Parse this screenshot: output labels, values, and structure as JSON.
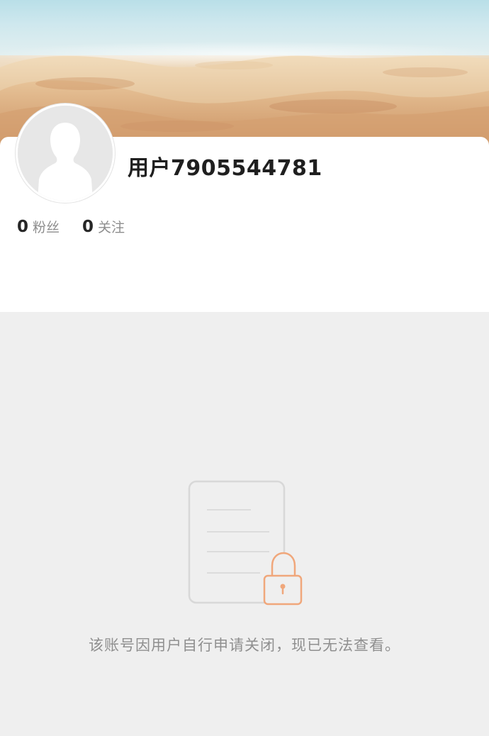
{
  "profile": {
    "username": "用户7905544781",
    "followers_count": "0",
    "followers_label": "粉丝",
    "following_count": "0",
    "following_label": "关注",
    "avatar_icon": "default-avatar-icon"
  },
  "empty_state": {
    "icon": "locked-document-icon",
    "message": "该账号因用户自行申请关闭，现已无法查看。"
  },
  "colors": {
    "background": "#efefef",
    "card": "#ffffff",
    "lock_accent": "#f0a77b",
    "document_stroke": "#d8d8d8"
  }
}
